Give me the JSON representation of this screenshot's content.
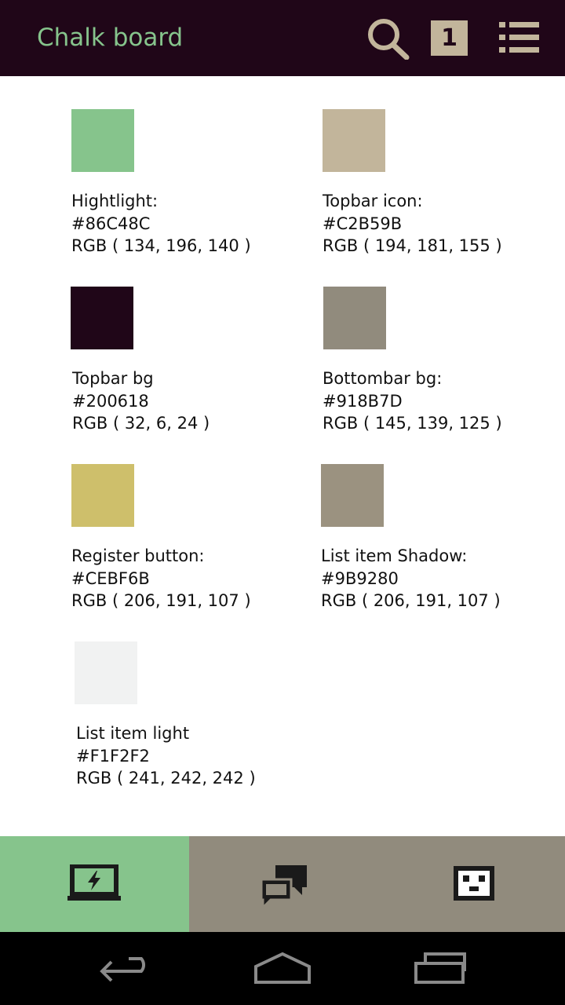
{
  "topbar": {
    "title": "Chalk board",
    "badge_count": "1",
    "icons": [
      "search-icon",
      "notification-badge",
      "menu-list-icon"
    ]
  },
  "colors": [
    {
      "label": "Hightlight:",
      "hex": "#86C48C",
      "rgb": "RGB ( 134, 196, 140 )",
      "swatch": "#86C48C"
    },
    {
      "label": "Topbar icon:",
      "hex": "#C2B59B",
      "rgb": "RGB ( 194, 181, 155 )",
      "swatch": "#C2B59B"
    },
    {
      "label": "Topbar bg",
      "hex": "#200618",
      "rgb": "RGB ( 32, 6, 24 )",
      "swatch": "#200618"
    },
    {
      "label": "Bottombar bg:",
      "hex": "#918B7D",
      "rgb": "RGB ( 145, 139, 125 )",
      "swatch": "#918B7D"
    },
    {
      "label": "Register button:",
      "hex": "#CEBF6B",
      "rgb": "RGB ( 206, 191, 107 )",
      "swatch": "#CEBF6B"
    },
    {
      "label": "List item Shadow:",
      "hex": "#9B9280",
      "rgb": "RGB ( 206, 191, 107 )",
      "swatch": "#9B9280"
    },
    {
      "label": "List item light",
      "hex": "#F1F2F2",
      "rgb": "RGB ( 241, 242, 242 )",
      "swatch": "#F1F2F2"
    }
  ],
  "bottombar": {
    "tabs": [
      {
        "icon": "laptop-lightning-icon",
        "active": true
      },
      {
        "icon": "chat-bubbles-icon",
        "active": false
      },
      {
        "icon": "pixel-face-icon",
        "active": false
      }
    ]
  },
  "navbar": {
    "icons": [
      "back-icon",
      "home-icon",
      "recent-apps-icon"
    ]
  }
}
